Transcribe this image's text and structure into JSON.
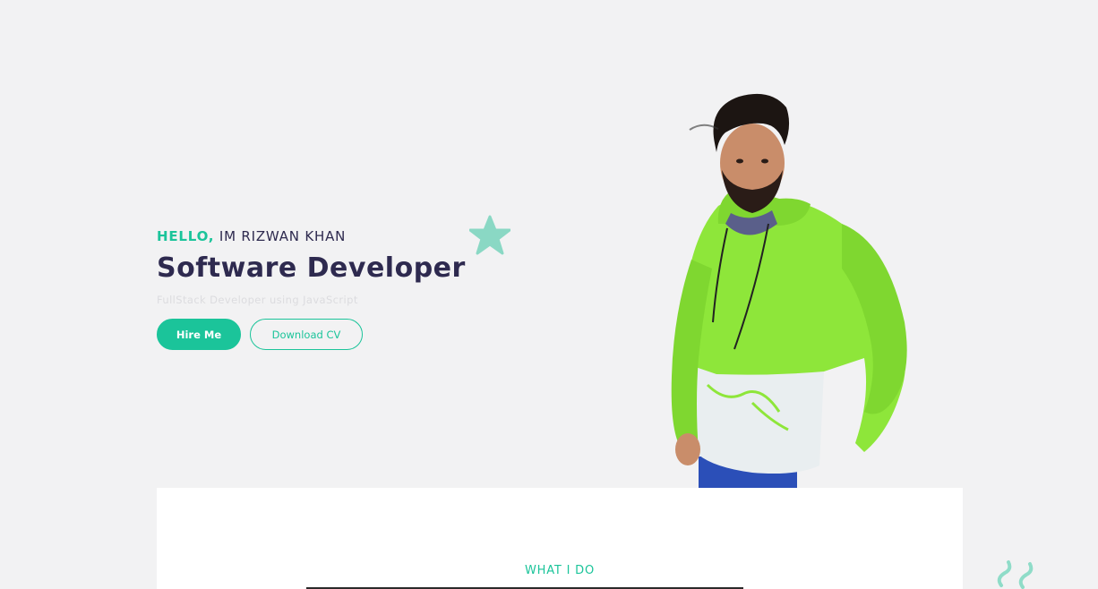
{
  "hero": {
    "greeting_accent": "HELLO,",
    "greeting_rest": " IM RIZWAN KHAN",
    "title": "Software Developer",
    "subtitle": "FullStack Developer using JavaScript"
  },
  "buttons": {
    "hire": "Hire Me",
    "download": "Download CV"
  },
  "services": {
    "label": "WHAT I DO"
  },
  "colors": {
    "accent": "#1bc49a",
    "heading": "#2e2a4f",
    "background": "#f2f2f3",
    "hoodie_green": "#8ee63a"
  },
  "icons": {
    "decor_star": "star-icon",
    "decor_squiggle": "squiggle-icon"
  }
}
